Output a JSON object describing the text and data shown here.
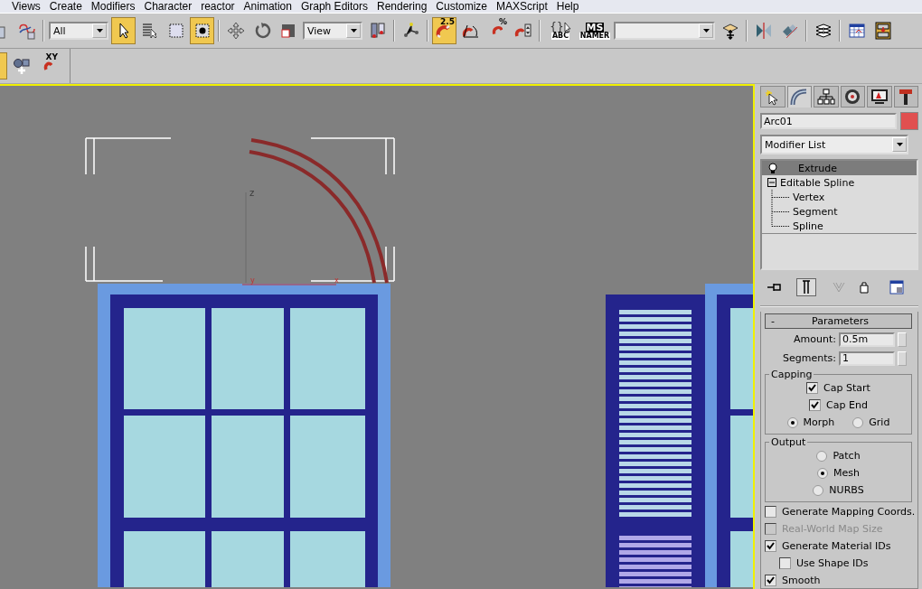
{
  "menu": [
    "Views",
    "Create",
    "Modifiers",
    "Character",
    "reactor",
    "Animation",
    "Graph Editors",
    "Rendering",
    "Customize",
    "MAXScript",
    "Help"
  ],
  "toolbar_main": [
    {
      "kind": "button",
      "active": false
    },
    {
      "kind": "button",
      "active": false
    },
    {
      "kind": "separator"
    },
    {
      "kind": "dropdown",
      "value": "All"
    },
    {
      "kind": "button",
      "active": true
    },
    {
      "kind": "button",
      "active": false
    },
    {
      "kind": "button",
      "active": false
    },
    {
      "kind": "button",
      "active": true
    },
    {
      "kind": "separator"
    },
    {
      "kind": "button",
      "active": false
    },
    {
      "kind": "button",
      "active": false
    },
    {
      "kind": "button",
      "active": false
    },
    {
      "kind": "dropdown",
      "value": "View"
    },
    {
      "kind": "button",
      "active": false
    },
    {
      "kind": "separator"
    },
    {
      "kind": "button",
      "active": false
    },
    {
      "kind": "separator"
    },
    {
      "kind": "button",
      "active": true,
      "label": "2.5"
    },
    {
      "kind": "button",
      "active": false
    },
    {
      "kind": "button",
      "active": false,
      "label": "%"
    },
    {
      "kind": "button",
      "active": false
    },
    {
      "kind": "separator"
    },
    {
      "kind": "button",
      "active": false,
      "label": "{}",
      "sublabel": "ABC"
    },
    {
      "kind": "button",
      "active": false,
      "label": "MS",
      "sublabel": "NAMER"
    },
    {
      "kind": "dropdown"
    },
    {
      "kind": "button",
      "active": false
    },
    {
      "kind": "separator"
    },
    {
      "kind": "button",
      "active": false
    },
    {
      "kind": "button",
      "active": false
    },
    {
      "kind": "separator"
    },
    {
      "kind": "button",
      "active": false
    },
    {
      "kind": "separator"
    },
    {
      "kind": "button",
      "active": false
    },
    {
      "kind": "button",
      "active": false
    }
  ],
  "toolbar_secondary": [
    {
      "kind": "button",
      "active": true
    },
    {
      "kind": "button",
      "active": false
    },
    {
      "kind": "button",
      "active": false,
      "label": "XY"
    }
  ],
  "viewport": {
    "axis_labels": [
      "z",
      "y",
      "x"
    ]
  },
  "command_panel": {
    "tabs": [
      {
        "selected": false
      },
      {
        "selected": true
      },
      {
        "selected": false
      },
      {
        "selected": false
      },
      {
        "selected": false
      },
      {
        "selected": false
      }
    ],
    "object_name": "Arc01",
    "modifier_list": "Modifier List",
    "stack": [
      {
        "kind": "modifier",
        "label": "Extrude",
        "selected": true
      },
      {
        "kind": "object",
        "label": "Editable Spline",
        "selected": false,
        "expanded": true,
        "children": [
          {
            "label": "Vertex",
            "selected": false
          },
          {
            "label": "Segment",
            "selected": false
          },
          {
            "label": "Spline",
            "selected": false
          }
        ]
      }
    ],
    "stack_buttons": [
      {
        "active": false,
        "disabled": false
      },
      {
        "active": true,
        "disabled": false
      },
      {
        "active": false,
        "disabled": true
      },
      {
        "active": false,
        "disabled": false
      },
      {
        "active": false,
        "disabled": false
      }
    ],
    "rollout": {
      "collapse": "-",
      "title": "Parameters",
      "fields": [
        {
          "label": "Amount:",
          "value": "0.5m"
        },
        {
          "label": "Segments:",
          "value": "1"
        }
      ],
      "capping": {
        "title": "Capping",
        "checks": [
          {
            "label": "Cap Start",
            "checked": true
          },
          {
            "label": "Cap End",
            "checked": true
          }
        ],
        "radios": [
          {
            "label": "Morph",
            "selected": true
          },
          {
            "label": "Grid",
            "selected": false
          }
        ]
      },
      "output": {
        "title": "Output",
        "radios": [
          {
            "label": "Patch",
            "selected": false
          },
          {
            "label": "Mesh",
            "selected": true
          },
          {
            "label": "NURBS",
            "selected": false
          }
        ]
      },
      "options": [
        {
          "label": "Generate Mapping Coords.",
          "checked": false,
          "disabled": false
        },
        {
          "label": "Real-World Map Size",
          "checked": false,
          "disabled": true
        },
        {
          "label": "Generate Material IDs",
          "checked": true,
          "disabled": false,
          "children": [
            {
              "label": "Use Shape IDs",
              "checked": false,
              "disabled": false
            }
          ]
        },
        {
          "label": "Smooth",
          "checked": true,
          "disabled": false
        }
      ]
    }
  }
}
